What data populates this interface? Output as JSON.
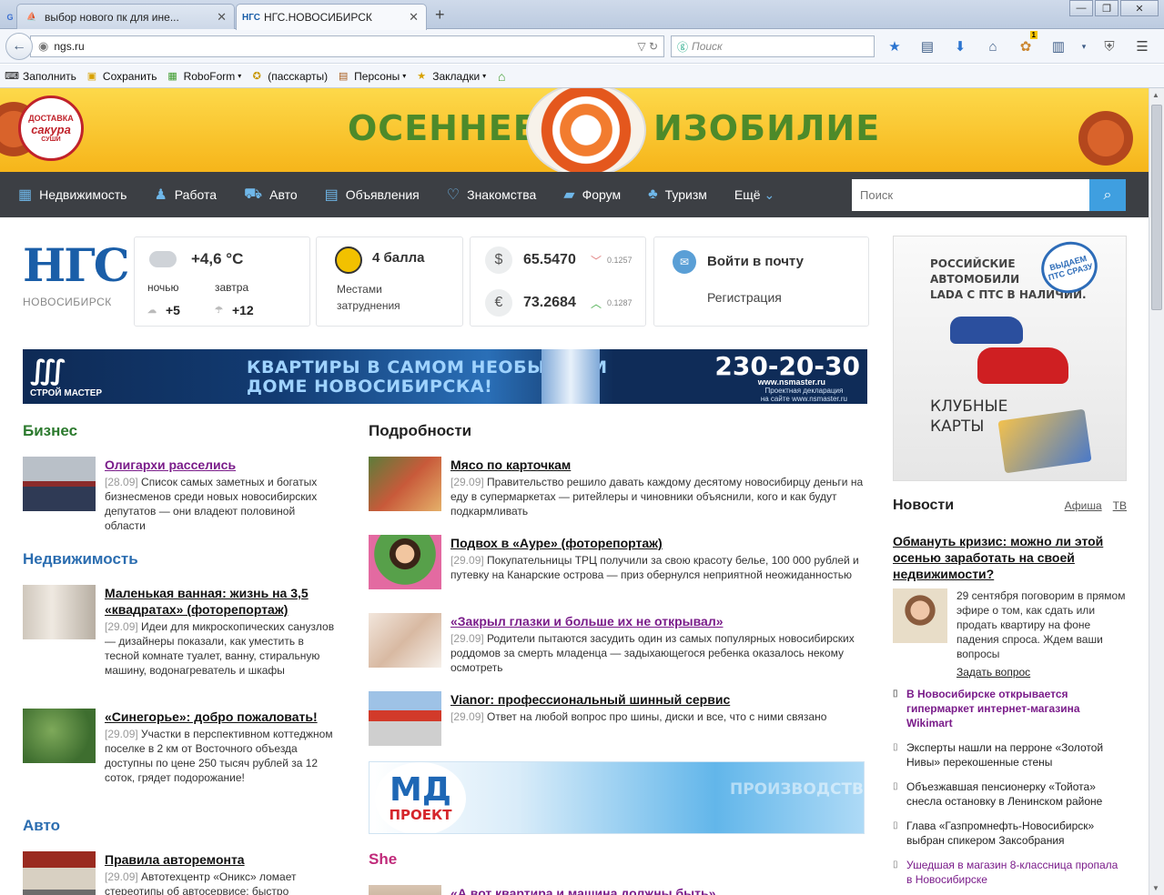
{
  "browser": {
    "tabs": [
      {
        "title": "выбор нового пк для ине...",
        "favicon": "forum-favicon"
      },
      {
        "title": "НГС.НОВОСИБИРСК",
        "favicon": "ngs-favicon"
      }
    ],
    "address": "ngs.ru",
    "search_placeholder": "Поиск",
    "badge_count": "1",
    "bookmarks": [
      {
        "label": "Заполнить"
      },
      {
        "label": "Сохранить"
      },
      {
        "label": "RoboForm"
      },
      {
        "label": "(пасскарты)"
      },
      {
        "label": "Персоны"
      },
      {
        "label": "Закладки"
      }
    ]
  },
  "banner": {
    "word1": "ОСЕННЕЕ",
    "word2": "ИЗОБИЛИЕ",
    "logo_top": "ДОСТАВКА",
    "logo_brand": "сакура",
    "logo_bottom": "СУШИ"
  },
  "nav": {
    "items": [
      {
        "label": "Недвижимость"
      },
      {
        "label": "Работа"
      },
      {
        "label": "Авто"
      },
      {
        "label": "Объявления"
      },
      {
        "label": "Знакомства"
      },
      {
        "label": "Форум"
      },
      {
        "label": "Туризм"
      }
    ],
    "more": "Ещё",
    "search_placeholder": "Поиск"
  },
  "logo": {
    "mark": "НГС",
    "city": "НОВОСИБИРСК"
  },
  "weather": {
    "current": "+4,6 °C",
    "night_label": "ночью",
    "night_temp": "+5",
    "tomorrow_label": "завтра",
    "tomorrow_temp": "+12"
  },
  "traffic": {
    "score": "4 балла",
    "desc": "Местами затруднения"
  },
  "rates": {
    "usd": {
      "symbol": "$",
      "value": "65.5470",
      "delta": "0.1257"
    },
    "eur": {
      "symbol": "€",
      "value": "73.2684",
      "delta": "0.1287"
    }
  },
  "mail": {
    "login": "Войти в почту",
    "register": "Регистрация"
  },
  "ad_wide": {
    "brand": "СТРОЙ МАСТЕР",
    "slogan1": "КВАРТИРЫ В САМОМ НЕОБЫЧНОМ",
    "slogan2": "ДОМЕ НОВОСИБИРСКА!",
    "phone": "230-20-30",
    "site": "www.nsmaster.ru",
    "note1": "Проектная декларация",
    "note2": "на сайте www.nsmaster.ru"
  },
  "ad_side": {
    "line1": "РОССИЙСКИЕ",
    "line2": "АВТОМОБИЛИ",
    "line3": "LADA С ПТС В НАЛИЧИИ.",
    "seal": "ВЫДАЕМ ПТС СРАЗУ",
    "clubs1": "КЛУБНЫЕ",
    "clubs2": "КАРТЫ"
  },
  "ad_mid": {
    "brand": "МД",
    "brand2": "ПРОЕКТ",
    "text": "ПРОИЗВОДСТВ"
  },
  "sections": {
    "business": "Бизнес",
    "realty": "Недвижимость",
    "auto": "Авто",
    "details": "Подробности",
    "she": "She"
  },
  "left_news": [
    {
      "title": "Олигархи расселись",
      "date": "[28.09]",
      "text": "Список самых заметных и богатых бизнесменов среди новых новосибирских депутатов — они владеют половиной области"
    },
    {
      "title": "Маленькая ванная: жизнь на 3,5 «квадратах» (фоторепортаж)",
      "date": "[29.09]",
      "text": "Идеи для микроскопических санузлов — дизайнеры показали, как уместить в тесной комнате туалет, ванну, стиральную машину, водонагреватель и шкафы"
    },
    {
      "title": "«Синегорье»: добро пожаловать!",
      "date": "[29.09]",
      "text": "Участки в перспективном коттеджном поселке в 2 км от Восточного объезда доступны по цене 250 тысяч рублей за 12 соток, грядет подорожание!"
    },
    {
      "title": "Правила авторемонта",
      "date": "[29.09]",
      "text": "Автотехцентр «Оникс» ломает стереотипы об автосервисе: быстро"
    }
  ],
  "mid_news": [
    {
      "title": "Мясо по карточкам",
      "date": "[29.09]",
      "text": "Правительство решило давать каждому десятому новосибирцу деньги на еду в супермаркетах — ритейлеры и чиновники объяснили, кого и как будут подкармливать"
    },
    {
      "title": "Подвох в «Ауре» (фоторепортаж)",
      "date": "[29.09]",
      "text": "Покупательницы ТРЦ получили за свою красоту белье, 100 000 рублей и путевку на Канарские острова — приз обернулся неприятной неожиданностью"
    },
    {
      "title": "«Закрыл глазки и больше их не открывал»",
      "date": "[29.09]",
      "text": "Родители пытаются засудить один из самых популярных новосибирских роддомов за смерть младенца — задыхающегося ребенка оказалось некому осмотреть"
    },
    {
      "title": "Vianor: профессиональный шинный сервис",
      "date": "[29.09]",
      "text": "Ответ на любой вопрос про шины, диски и все, что с ними связано"
    },
    {
      "title": "«А вот квартира и машина должны быть»"
    }
  ],
  "right": {
    "title": "Новости",
    "link1": "Афиша",
    "link2": "ТВ",
    "feature_title": "Обмануть кризис: можно ли этой осенью заработать на своей недвижимости?",
    "feature_text": "29 сентября поговорим в прямом эфире о том, как сдать или продать квартиру на фоне падения спроса. Ждем ваши вопросы",
    "ask": "Задать вопрос",
    "list": [
      {
        "text": "В Новосибирске открывается гипермаркет интернет-магазина Wikimart"
      },
      {
        "text": "Эксперты нашли на перроне «Золотой Нивы» перекошенные стены"
      },
      {
        "text": "Объезжавшая пенсионерку «Тойота» снесла остановку в Ленинском районе"
      },
      {
        "text": "Глава «Газпромнефть-Новосибирск» выбран спикером Заксобрания"
      },
      {
        "text": "Ушедшая в магазин 8-классница пропала в Новосибирске"
      }
    ]
  }
}
